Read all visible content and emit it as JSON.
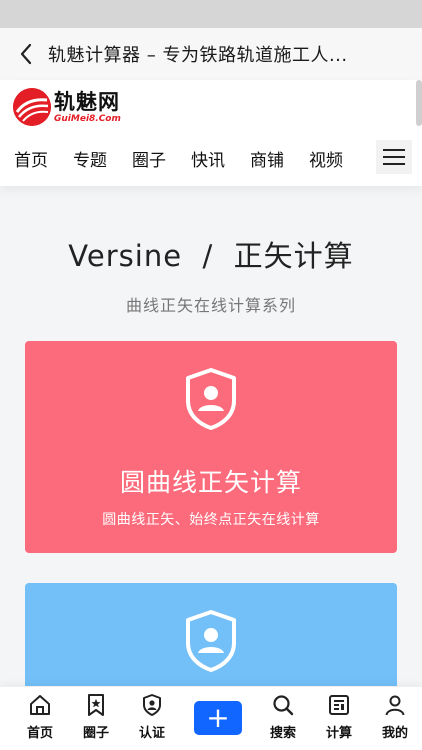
{
  "title_bar": {
    "title": "轨魅计算器 – 专为铁路轨道施工人..."
  },
  "logo": {
    "cn": "轨魅网",
    "en": "GuiMei8.Com"
  },
  "nav": {
    "items": [
      "首页",
      "专题",
      "圈子",
      "快讯",
      "商铺",
      "视频"
    ]
  },
  "hero": {
    "title": "Versine  /  正矢计算",
    "subtitle": "曲线正矢在线计算系列"
  },
  "cards": [
    {
      "title": "圆曲线正矢计算",
      "desc": "圆曲线正矢、始终点正矢在线计算",
      "color": "#fc6b7c"
    },
    {
      "title": "",
      "desc": "",
      "color": "#73bff8"
    }
  ],
  "tab_bar": {
    "items": [
      "首页",
      "圈子",
      "认证",
      "搜索",
      "计算",
      "我的"
    ],
    "add_symbol": "+",
    "accent": "#1166ff"
  }
}
